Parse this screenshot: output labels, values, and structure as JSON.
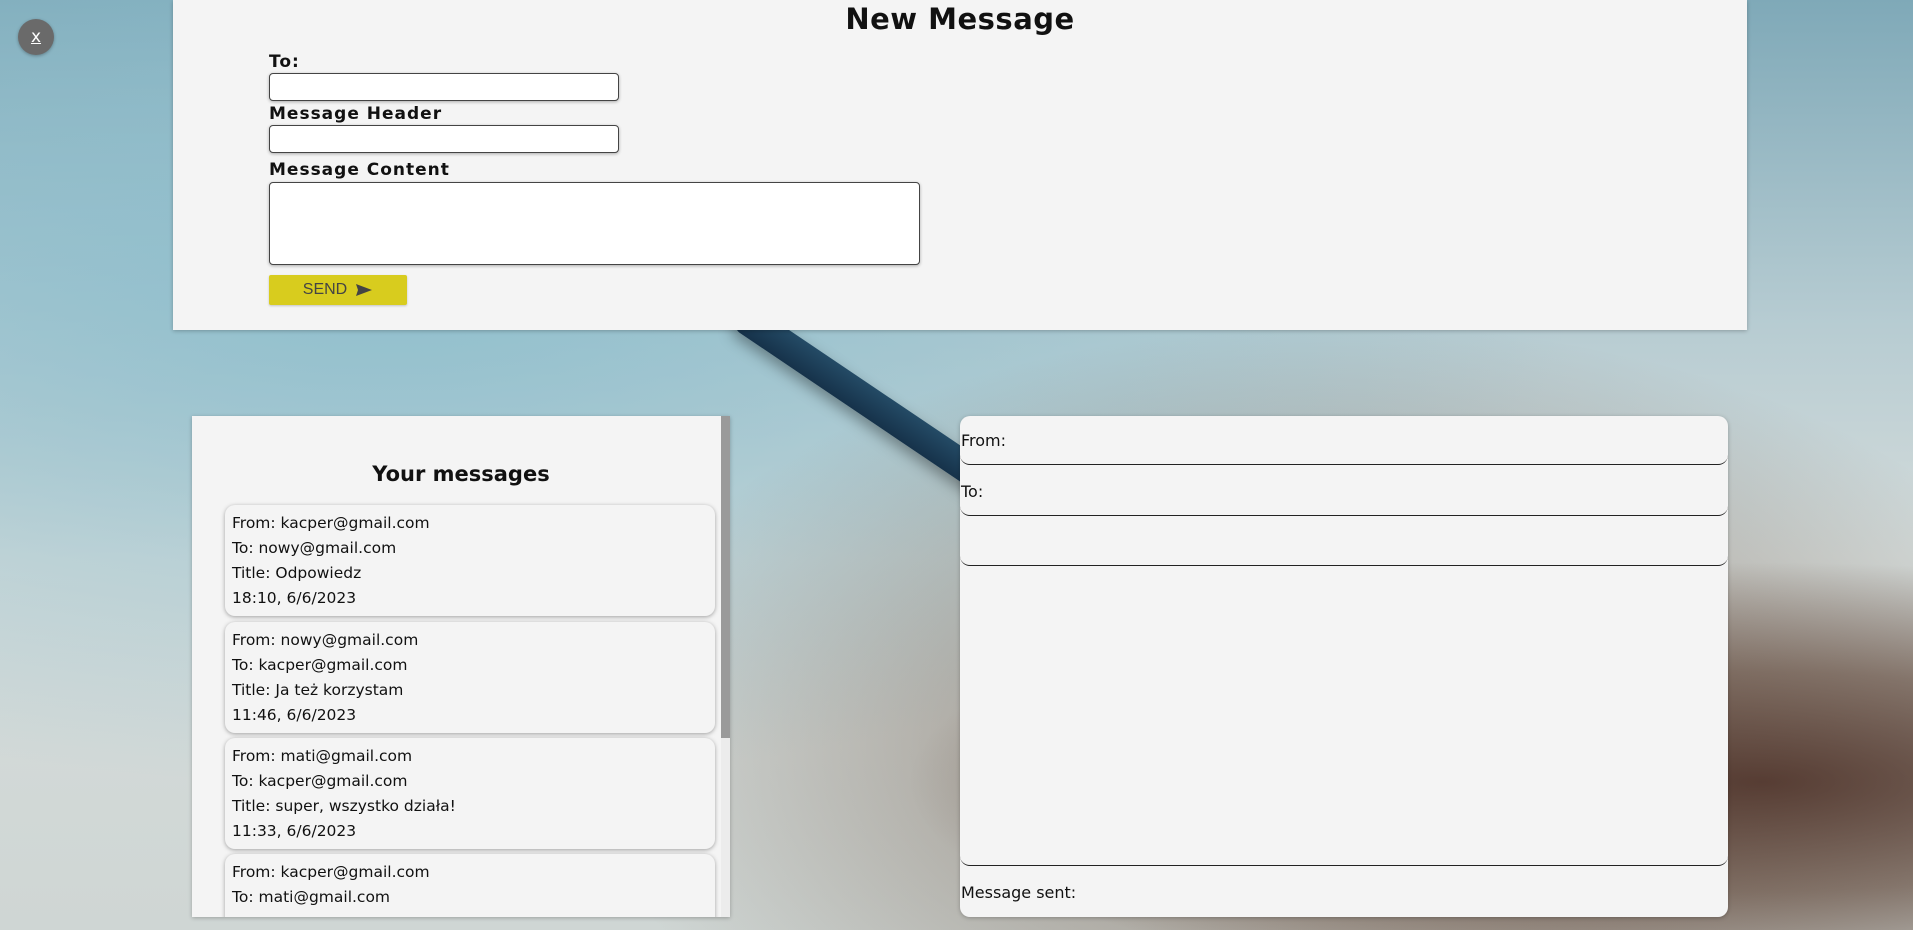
{
  "close_button": {
    "label": "x"
  },
  "compose": {
    "title": "New Message",
    "to_label": "To:",
    "to_value": "",
    "header_label": "Message Header",
    "header_value": "",
    "content_label": "Message Content",
    "content_value": "",
    "send_label": "SEND",
    "send_icon": "send-arrow-icon"
  },
  "inbox": {
    "title": "Your messages",
    "messages": [
      {
        "from": "From: kacper@gmail.com",
        "to": "To: nowy@gmail.com",
        "title": "Title: Odpowiedz",
        "time": "18:10, 6/6/2023"
      },
      {
        "from": "From: nowy@gmail.com",
        "to": "To: kacper@gmail.com",
        "title": "Title: Ja też korzystam",
        "time": "11:46, 6/6/2023"
      },
      {
        "from": "From: mati@gmail.com",
        "to": "To: kacper@gmail.com",
        "title": "Title: super, wszystko działa!",
        "time": "11:33, 6/6/2023"
      },
      {
        "from": "From: kacper@gmail.com",
        "to": "To: mati@gmail.com",
        "title": "",
        "time": ""
      }
    ]
  },
  "detail": {
    "from_label": "From:",
    "to_label": "To:",
    "title_value": "",
    "body_value": "",
    "sent_label": "Message sent:"
  },
  "colors": {
    "send_button": "#d8cc1e",
    "panel_bg": "#f4f4f4",
    "close_button_bg": "#6a6a6a"
  }
}
